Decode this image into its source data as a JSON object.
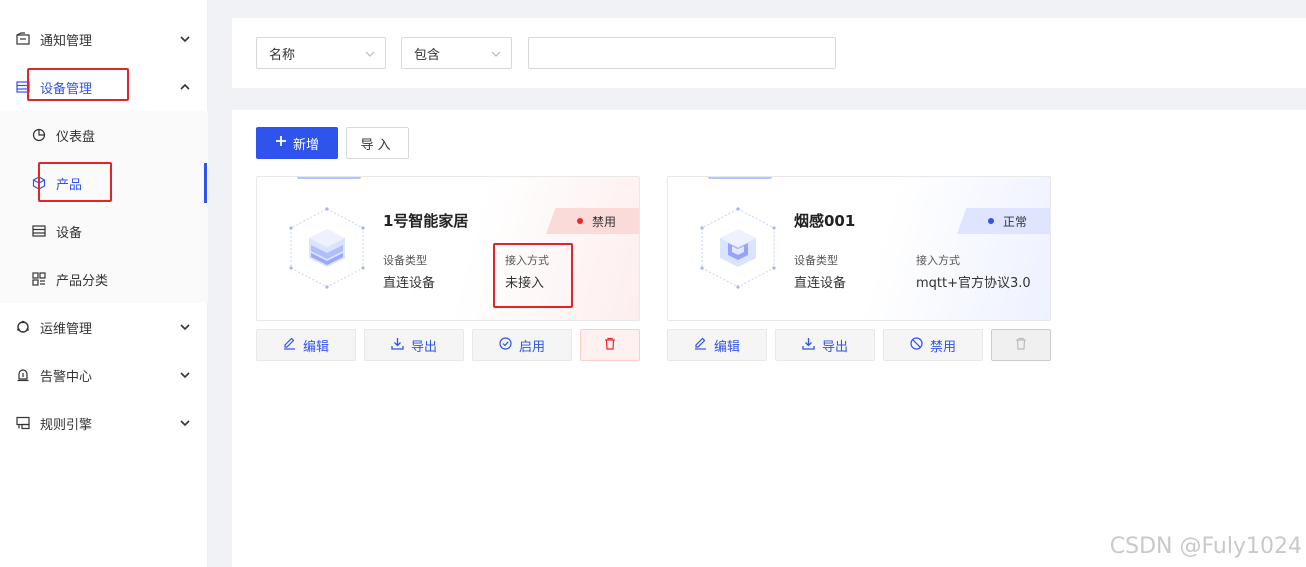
{
  "sidebar": {
    "items": [
      {
        "label": "通知管理",
        "icon": "notice-icon"
      },
      {
        "label": "设备管理",
        "icon": "device-manage-icon"
      },
      {
        "label": "仪表盘",
        "icon": "dashboard-icon"
      },
      {
        "label": "产品",
        "icon": "product-icon"
      },
      {
        "label": "设备",
        "icon": "device-icon"
      },
      {
        "label": "产品分类",
        "icon": "category-icon"
      },
      {
        "label": "运维管理",
        "icon": "ops-icon"
      },
      {
        "label": "告警中心",
        "icon": "alarm-icon"
      },
      {
        "label": "规则引擎",
        "icon": "rule-icon"
      }
    ]
  },
  "search": {
    "field_select": "名称",
    "operator_select": "包含",
    "value": ""
  },
  "toolbar": {
    "add_label": "新增",
    "import_label": "导入"
  },
  "cards": [
    {
      "title": "1号智能家居",
      "status": "禁用",
      "status_color": "#f5222d",
      "device_type_label": "设备类型",
      "device_type": "直连设备",
      "access_label": "接入方式",
      "access": "未接入",
      "actions": {
        "edit": "编辑",
        "export": "导出",
        "toggle": "启用"
      }
    },
    {
      "title": "烟感001",
      "status": "正常",
      "status_color": "#2f54eb",
      "device_type_label": "设备类型",
      "device_type": "直连设备",
      "access_label": "接入方式",
      "access": "mqtt+官方协议3.0",
      "actions": {
        "edit": "编辑",
        "export": "导出",
        "toggle": "禁用"
      }
    }
  ],
  "colors": {
    "primary": "#2f54eb",
    "danger": "#f5222d",
    "annotation": "#e0262a"
  },
  "watermark": "CSDN @Fuly1024"
}
